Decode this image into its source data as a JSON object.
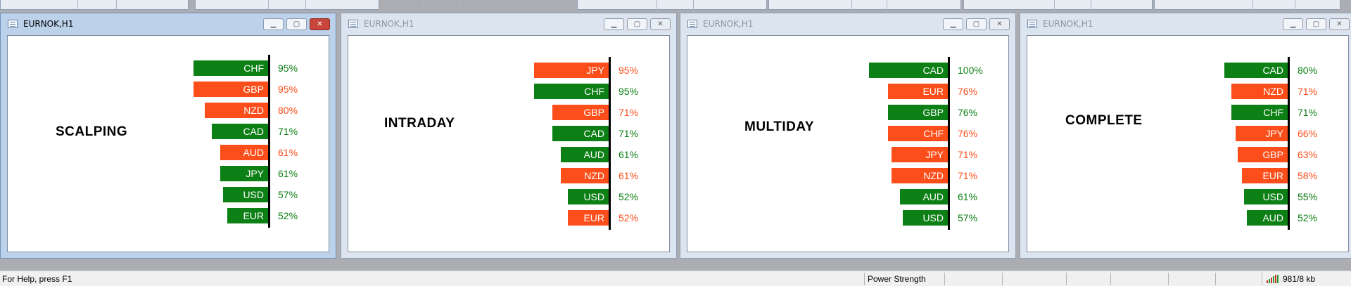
{
  "colors": {
    "strong": "#0c7f15",
    "weak": "#fb4e1a"
  },
  "windows": [
    {
      "title": "EURNOK,H1",
      "mode": "SCALPING",
      "active": true,
      "rows": [
        {
          "cur": "CHF",
          "pct": "95%",
          "value": 95,
          "color": "green"
        },
        {
          "cur": "GBP",
          "pct": "95%",
          "value": 95,
          "color": "red"
        },
        {
          "cur": "NZD",
          "pct": "80%",
          "value": 80,
          "color": "red"
        },
        {
          "cur": "CAD",
          "pct": "71%",
          "value": 71,
          "color": "green"
        },
        {
          "cur": "AUD",
          "pct": "61%",
          "value": 61,
          "color": "red"
        },
        {
          "cur": "JPY",
          "pct": "61%",
          "value": 61,
          "color": "green"
        },
        {
          "cur": "USD",
          "pct": "57%",
          "value": 57,
          "color": "green"
        },
        {
          "cur": "EUR",
          "pct": "52%",
          "value": 52,
          "color": "green"
        }
      ]
    },
    {
      "title": "EURNOK,H1",
      "mode": "INTRADAY",
      "active": false,
      "rows": [
        {
          "cur": "JPY",
          "pct": "95%",
          "value": 95,
          "color": "red"
        },
        {
          "cur": "CHF",
          "pct": "95%",
          "value": 95,
          "color": "green"
        },
        {
          "cur": "GBP",
          "pct": "71%",
          "value": 71,
          "color": "red"
        },
        {
          "cur": "CAD",
          "pct": "71%",
          "value": 71,
          "color": "green"
        },
        {
          "cur": "AUD",
          "pct": "61%",
          "value": 61,
          "color": "green"
        },
        {
          "cur": "NZD",
          "pct": "61%",
          "value": 61,
          "color": "red"
        },
        {
          "cur": "USD",
          "pct": "52%",
          "value": 52,
          "color": "green"
        },
        {
          "cur": "EUR",
          "pct": "52%",
          "value": 52,
          "color": "red"
        }
      ]
    },
    {
      "title": "EURNOK,H1",
      "mode": "MULTIDAY",
      "active": false,
      "rows": [
        {
          "cur": "CAD",
          "pct": "100%",
          "value": 100,
          "color": "green"
        },
        {
          "cur": "EUR",
          "pct": "76%",
          "value": 76,
          "color": "red"
        },
        {
          "cur": "GBP",
          "pct": "76%",
          "value": 76,
          "color": "green"
        },
        {
          "cur": "CHF",
          "pct": "76%",
          "value": 76,
          "color": "red"
        },
        {
          "cur": "JPY",
          "pct": "71%",
          "value": 71,
          "color": "red"
        },
        {
          "cur": "NZD",
          "pct": "71%",
          "value": 71,
          "color": "red"
        },
        {
          "cur": "AUD",
          "pct": "61%",
          "value": 61,
          "color": "green"
        },
        {
          "cur": "USD",
          "pct": "57%",
          "value": 57,
          "color": "green"
        }
      ]
    },
    {
      "title": "EURNOK,H1",
      "mode": "COMPLETE",
      "active": false,
      "rows": [
        {
          "cur": "CAD",
          "pct": "80%",
          "value": 80,
          "color": "green"
        },
        {
          "cur": "NZD",
          "pct": "71%",
          "value": 71,
          "color": "red"
        },
        {
          "cur": "CHF",
          "pct": "71%",
          "value": 71,
          "color": "green"
        },
        {
          "cur": "JPY",
          "pct": "66%",
          "value": 66,
          "color": "red"
        },
        {
          "cur": "GBP",
          "pct": "63%",
          "value": 63,
          "color": "red"
        },
        {
          "cur": "EUR",
          "pct": "58%",
          "value": 58,
          "color": "red"
        },
        {
          "cur": "USD",
          "pct": "55%",
          "value": 55,
          "color": "green"
        },
        {
          "cur": "AUD",
          "pct": "52%",
          "value": 52,
          "color": "green"
        }
      ]
    }
  ],
  "statusbar": {
    "help": "For Help, press F1",
    "profile": "Power Strength",
    "traffic": "981/8 kb"
  },
  "icons": {
    "window": "chart-window-icon",
    "minimize": "minimize-icon",
    "maximize": "maximize-icon",
    "close": "close-icon",
    "connection": "connection-bars-icon"
  }
}
